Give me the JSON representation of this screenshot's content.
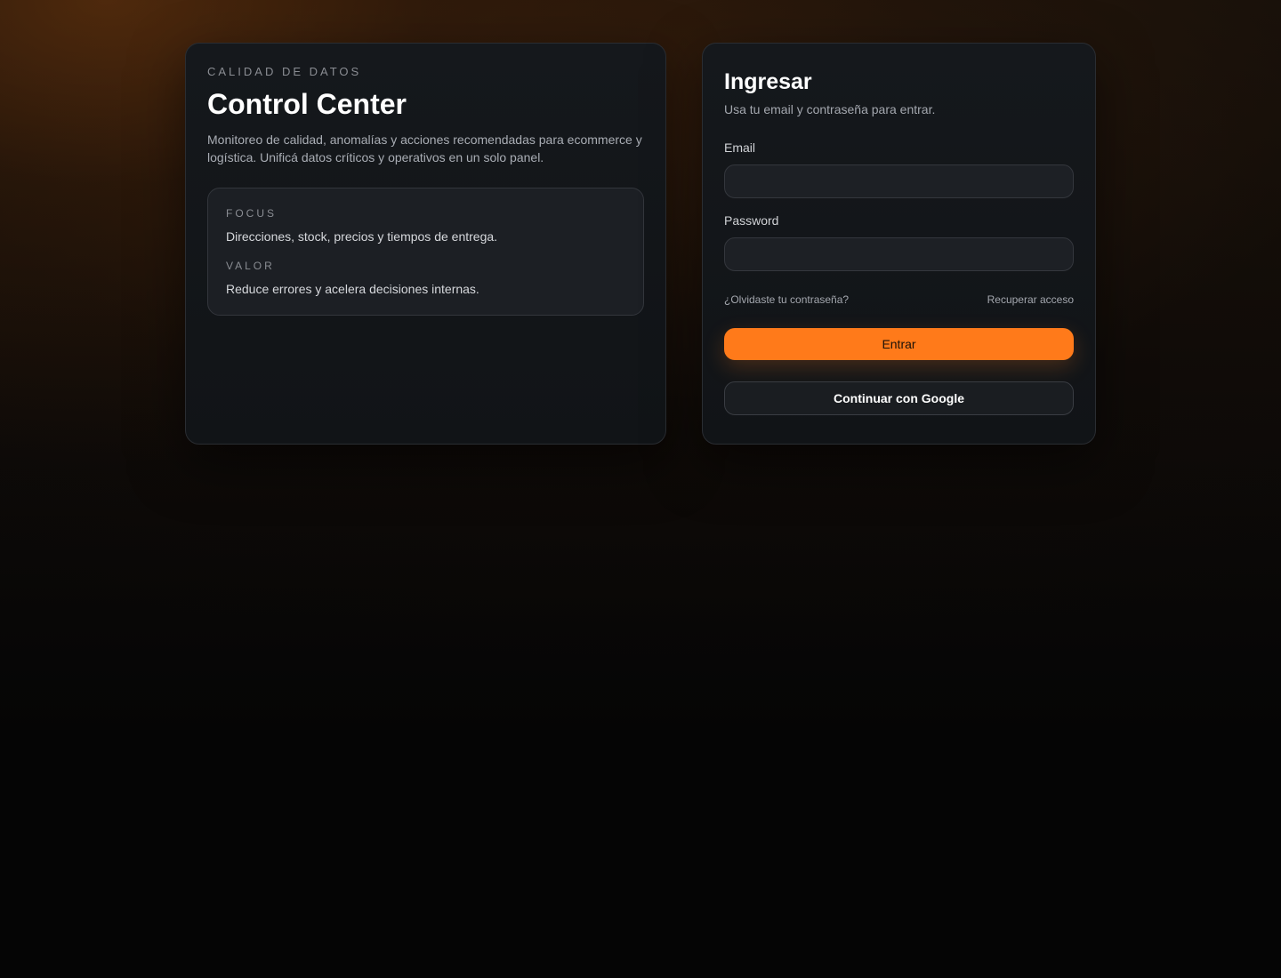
{
  "intro": {
    "eyebrow": "CALIDAD DE DATOS",
    "title": "Control Center",
    "description": "Monitoreo de calidad, anomalías y acciones recomendadas para ecommerce y logística. Unificá datos críticos y operativos en un solo panel.",
    "highlights": [
      {
        "label": "FOCUS",
        "text": "Direcciones, stock, precios y tiempos de entrega."
      },
      {
        "label": "VALOR",
        "text": "Reduce errores y acelera decisiones internas."
      }
    ]
  },
  "login": {
    "title": "Ingresar",
    "subtitle": "Usa tu email y contraseña para entrar.",
    "email_label": "Email",
    "email_value": "",
    "password_label": "Password",
    "password_value": "",
    "forgot_link": "¿Olvidaste tu contraseña?",
    "recover_link": "Recuperar acceso",
    "submit_label": "Entrar",
    "google_label": "Continuar con Google"
  },
  "colors": {
    "accent": "#ff7a1a",
    "card_bg": "#13161a",
    "page_bg": "#050505"
  }
}
